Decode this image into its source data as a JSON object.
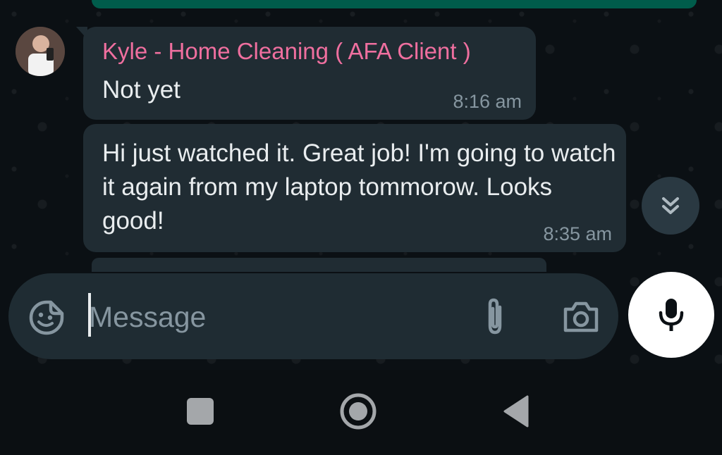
{
  "chat": {
    "messages": [
      {
        "sender": "Kyle - Home Cleaning ( AFA Client )",
        "text": "Not yet",
        "time": "8:16 am"
      },
      {
        "text": "Hi just watched it. Great job! I'm going to watch it again from my laptop tommorow. Looks good!",
        "time": "8:35 am"
      }
    ]
  },
  "composer": {
    "placeholder": "Message"
  },
  "icons": {
    "scroll_down": "double-chevron-down-icon",
    "emoji": "sticker-emoji-icon",
    "attach": "paperclip-icon",
    "camera": "camera-icon",
    "mic": "microphone-icon",
    "nav_recents": "square-icon",
    "nav_home": "circle-icon",
    "nav_back": "triangle-back-icon"
  },
  "colors": {
    "background": "#0b1014",
    "bubble": "#202c33",
    "sender_name": "#ef6f9f",
    "timestamp": "#8696a0",
    "outgoing_bubble": "#005c4b"
  }
}
